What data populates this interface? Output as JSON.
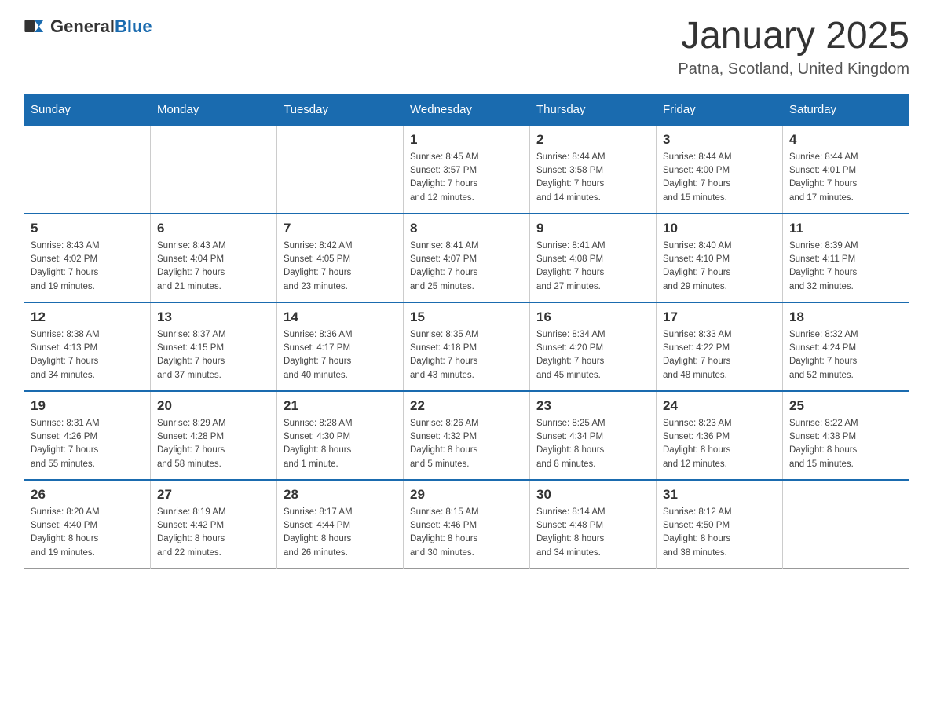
{
  "header": {
    "logo_general": "General",
    "logo_blue": "Blue",
    "month_year": "January 2025",
    "location": "Patna, Scotland, United Kingdom"
  },
  "weekdays": [
    "Sunday",
    "Monday",
    "Tuesday",
    "Wednesday",
    "Thursday",
    "Friday",
    "Saturday"
  ],
  "weeks": [
    [
      {
        "day": "",
        "info": ""
      },
      {
        "day": "",
        "info": ""
      },
      {
        "day": "",
        "info": ""
      },
      {
        "day": "1",
        "info": "Sunrise: 8:45 AM\nSunset: 3:57 PM\nDaylight: 7 hours\nand 12 minutes."
      },
      {
        "day": "2",
        "info": "Sunrise: 8:44 AM\nSunset: 3:58 PM\nDaylight: 7 hours\nand 14 minutes."
      },
      {
        "day": "3",
        "info": "Sunrise: 8:44 AM\nSunset: 4:00 PM\nDaylight: 7 hours\nand 15 minutes."
      },
      {
        "day": "4",
        "info": "Sunrise: 8:44 AM\nSunset: 4:01 PM\nDaylight: 7 hours\nand 17 minutes."
      }
    ],
    [
      {
        "day": "5",
        "info": "Sunrise: 8:43 AM\nSunset: 4:02 PM\nDaylight: 7 hours\nand 19 minutes."
      },
      {
        "day": "6",
        "info": "Sunrise: 8:43 AM\nSunset: 4:04 PM\nDaylight: 7 hours\nand 21 minutes."
      },
      {
        "day": "7",
        "info": "Sunrise: 8:42 AM\nSunset: 4:05 PM\nDaylight: 7 hours\nand 23 minutes."
      },
      {
        "day": "8",
        "info": "Sunrise: 8:41 AM\nSunset: 4:07 PM\nDaylight: 7 hours\nand 25 minutes."
      },
      {
        "day": "9",
        "info": "Sunrise: 8:41 AM\nSunset: 4:08 PM\nDaylight: 7 hours\nand 27 minutes."
      },
      {
        "day": "10",
        "info": "Sunrise: 8:40 AM\nSunset: 4:10 PM\nDaylight: 7 hours\nand 29 minutes."
      },
      {
        "day": "11",
        "info": "Sunrise: 8:39 AM\nSunset: 4:11 PM\nDaylight: 7 hours\nand 32 minutes."
      }
    ],
    [
      {
        "day": "12",
        "info": "Sunrise: 8:38 AM\nSunset: 4:13 PM\nDaylight: 7 hours\nand 34 minutes."
      },
      {
        "day": "13",
        "info": "Sunrise: 8:37 AM\nSunset: 4:15 PM\nDaylight: 7 hours\nand 37 minutes."
      },
      {
        "day": "14",
        "info": "Sunrise: 8:36 AM\nSunset: 4:17 PM\nDaylight: 7 hours\nand 40 minutes."
      },
      {
        "day": "15",
        "info": "Sunrise: 8:35 AM\nSunset: 4:18 PM\nDaylight: 7 hours\nand 43 minutes."
      },
      {
        "day": "16",
        "info": "Sunrise: 8:34 AM\nSunset: 4:20 PM\nDaylight: 7 hours\nand 45 minutes."
      },
      {
        "day": "17",
        "info": "Sunrise: 8:33 AM\nSunset: 4:22 PM\nDaylight: 7 hours\nand 48 minutes."
      },
      {
        "day": "18",
        "info": "Sunrise: 8:32 AM\nSunset: 4:24 PM\nDaylight: 7 hours\nand 52 minutes."
      }
    ],
    [
      {
        "day": "19",
        "info": "Sunrise: 8:31 AM\nSunset: 4:26 PM\nDaylight: 7 hours\nand 55 minutes."
      },
      {
        "day": "20",
        "info": "Sunrise: 8:29 AM\nSunset: 4:28 PM\nDaylight: 7 hours\nand 58 minutes."
      },
      {
        "day": "21",
        "info": "Sunrise: 8:28 AM\nSunset: 4:30 PM\nDaylight: 8 hours\nand 1 minute."
      },
      {
        "day": "22",
        "info": "Sunrise: 8:26 AM\nSunset: 4:32 PM\nDaylight: 8 hours\nand 5 minutes."
      },
      {
        "day": "23",
        "info": "Sunrise: 8:25 AM\nSunset: 4:34 PM\nDaylight: 8 hours\nand 8 minutes."
      },
      {
        "day": "24",
        "info": "Sunrise: 8:23 AM\nSunset: 4:36 PM\nDaylight: 8 hours\nand 12 minutes."
      },
      {
        "day": "25",
        "info": "Sunrise: 8:22 AM\nSunset: 4:38 PM\nDaylight: 8 hours\nand 15 minutes."
      }
    ],
    [
      {
        "day": "26",
        "info": "Sunrise: 8:20 AM\nSunset: 4:40 PM\nDaylight: 8 hours\nand 19 minutes."
      },
      {
        "day": "27",
        "info": "Sunrise: 8:19 AM\nSunset: 4:42 PM\nDaylight: 8 hours\nand 22 minutes."
      },
      {
        "day": "28",
        "info": "Sunrise: 8:17 AM\nSunset: 4:44 PM\nDaylight: 8 hours\nand 26 minutes."
      },
      {
        "day": "29",
        "info": "Sunrise: 8:15 AM\nSunset: 4:46 PM\nDaylight: 8 hours\nand 30 minutes."
      },
      {
        "day": "30",
        "info": "Sunrise: 8:14 AM\nSunset: 4:48 PM\nDaylight: 8 hours\nand 34 minutes."
      },
      {
        "day": "31",
        "info": "Sunrise: 8:12 AM\nSunset: 4:50 PM\nDaylight: 8 hours\nand 38 minutes."
      },
      {
        "day": "",
        "info": ""
      }
    ]
  ]
}
